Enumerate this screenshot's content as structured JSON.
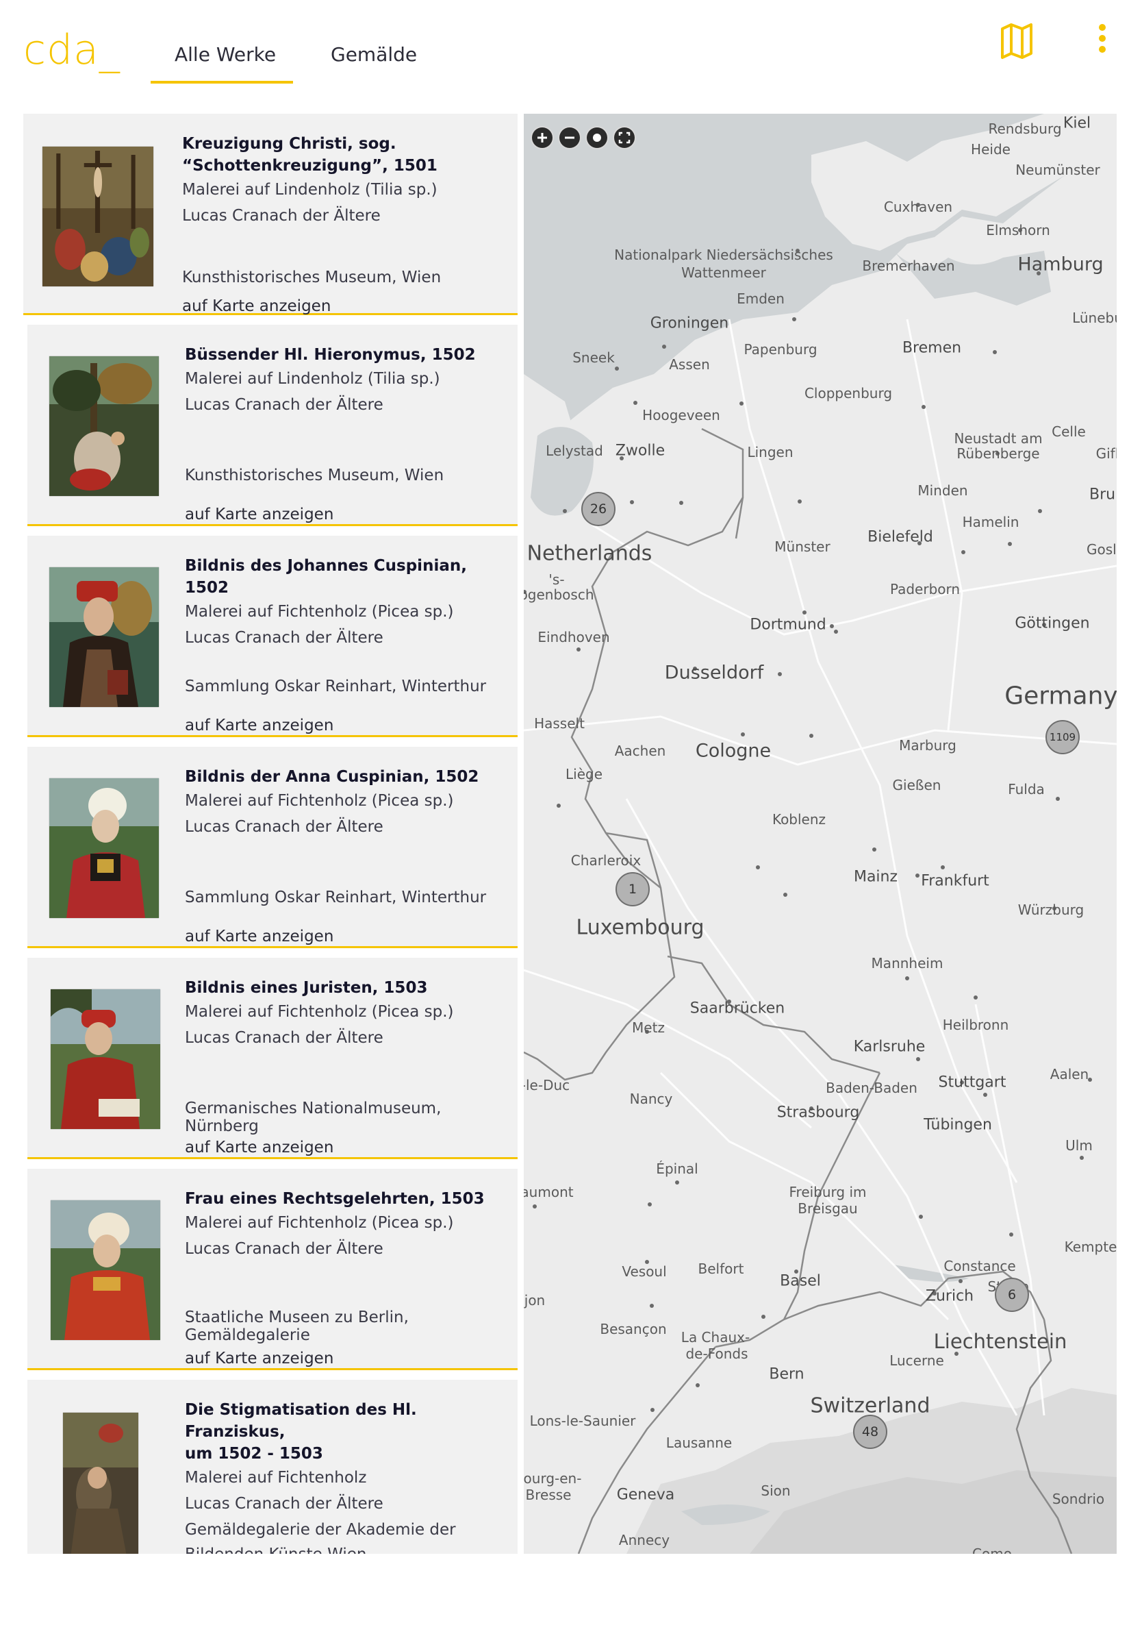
{
  "header": {
    "logo": "cda_",
    "tabs": [
      {
        "label": "Alle Werke",
        "active": true
      },
      {
        "label": "Gemälde",
        "active": false
      }
    ],
    "icons": [
      "map-icon",
      "more-vertical-icon"
    ],
    "accent_color": "#f5c400"
  },
  "works": [
    {
      "title": "Kreuzigung Christi, sog. “Schottenkreuzigung”, 1501",
      "title_lines": [
        "Kreuzigung Christi, sog.",
        "“Schottenkreuzigung”, 1501"
      ],
      "medium": "Malerei auf Lindenholz (Tilia sp.)",
      "artist": "Lucas Cranach der Ältere",
      "museum_lines": [
        "Kunsthistorisches Museum, Wien"
      ],
      "map_link": "auf Karte anzeigen"
    },
    {
      "title_lines": [
        "Büssender Hl. Hieronymus, 1502"
      ],
      "medium": "Malerei auf Lindenholz (Tilia sp.)",
      "artist": "Lucas Cranach der Ältere",
      "museum_lines": [
        "Kunsthistorisches Museum, Wien"
      ],
      "map_link": "auf Karte anzeigen"
    },
    {
      "title_lines": [
        "Bildnis des Johannes Cuspinian, 1502"
      ],
      "medium": "Malerei auf Fichtenholz (Picea sp.)",
      "artist": "Lucas Cranach der Ältere",
      "museum_lines": [
        "Sammlung Oskar Reinhart, Winterthur"
      ],
      "map_link": "auf Karte anzeigen"
    },
    {
      "title_lines": [
        "Bildnis der Anna Cuspinian, 1502"
      ],
      "medium": "Malerei auf Fichtenholz (Picea sp.)",
      "artist": "Lucas Cranach der Ältere",
      "museum_lines": [
        "Sammlung Oskar Reinhart, Winterthur"
      ],
      "map_link": "auf Karte anzeigen"
    },
    {
      "title_lines": [
        "Bildnis eines Juristen, 1503"
      ],
      "medium": "Malerei auf Fichtenholz (Picea sp.)",
      "artist": "Lucas Cranach der Ältere",
      "museum_lines": [
        "Germanisches Nationalmuseum, Nürnberg"
      ],
      "map_link": "auf Karte anzeigen"
    },
    {
      "title_lines": [
        "Frau eines Rechtsgelehrten, 1503"
      ],
      "medium": "Malerei auf Fichtenholz (Picea sp.)",
      "artist": "Lucas Cranach der Ältere",
      "museum_lines": [
        "Staatliche Museen zu Berlin,",
        "Gemäldegalerie"
      ],
      "map_link": "auf Karte anzeigen"
    },
    {
      "title_lines": [
        "Die Stigmatisation des Hl. Franziskus,",
        "um 1502 - 1503"
      ],
      "medium": "Malerei auf Fichtenholz",
      "artist": "Lucas Cranach der Ältere",
      "museum_lines": [
        "Gemäldegalerie der Akademie der",
        "Bildenden Künste Wien"
      ],
      "map_link": ""
    }
  ],
  "map": {
    "controls": [
      "zoom-in-icon",
      "zoom-out-icon",
      "locate-icon",
      "fullscreen-icon"
    ],
    "clusters": [
      "26",
      "1109",
      "1",
      "6",
      "48"
    ],
    "places": {
      "countries": [
        "Netherlands",
        "Germany",
        "Luxembourg",
        "Liechtenstein",
        "Switzerland"
      ],
      "cities": [
        "Rendsburg",
        "Kiel",
        "Heide",
        "Neumünster",
        "Cuxhaven",
        "Elmshorn",
        "Hamburg",
        "Nationalpark Niedersächsisches",
        "Wattenmeer",
        "Bremerhaven",
        "Emden",
        "Lünebu",
        "Groningen",
        "Papenburg",
        "Bremen",
        "Sneek",
        "Assen",
        "Cloppenburg",
        "Hoogeveen",
        "Neustadt am",
        "Rübenberge",
        "Celle",
        "Lelystad",
        "Zwolle",
        "Lingen",
        "Gifh",
        "Minden",
        "Brun",
        "Hamelin",
        "Münster",
        "Bielefeld",
        "Gosla",
        "'s-",
        "rtogenbosch",
        "Paderborn",
        "Eindhoven",
        "Dortmund",
        "Göttingen",
        "Dusseldorf",
        "Hasselt",
        "Aachen",
        "Cologne",
        "Marburg",
        "Liège",
        "Gießen",
        "Fulda",
        "Koblenz",
        "Charleroix",
        "Mainz",
        "Frankfurt",
        "Würzburg",
        "Mannheim",
        "Saarbrücken",
        "Heilbronn",
        "Metz",
        "Karlsruhe",
        "r-le-Duc",
        "Baden-Baden",
        "Stuttgart",
        "Aalen",
        "Nancy",
        "Strasbourg",
        "Tübingen",
        "Ulm",
        "aumont",
        "Épinal",
        "Freiburg im",
        "Breisgau",
        "Kempte",
        "Vesoul",
        "Belfort",
        "Constance",
        "Basel",
        "St. Ga",
        "jon",
        "Zurich",
        "Besançon",
        "La Chaux-",
        "de-Fonds",
        "Lucerne",
        "Bern",
        "Lons-le-Saunier",
        "Lausanne",
        "ourg-en-",
        "Bresse",
        "Geneva",
        "Sion",
        "Sondrio",
        "Annecy",
        "Como"
      ]
    }
  }
}
